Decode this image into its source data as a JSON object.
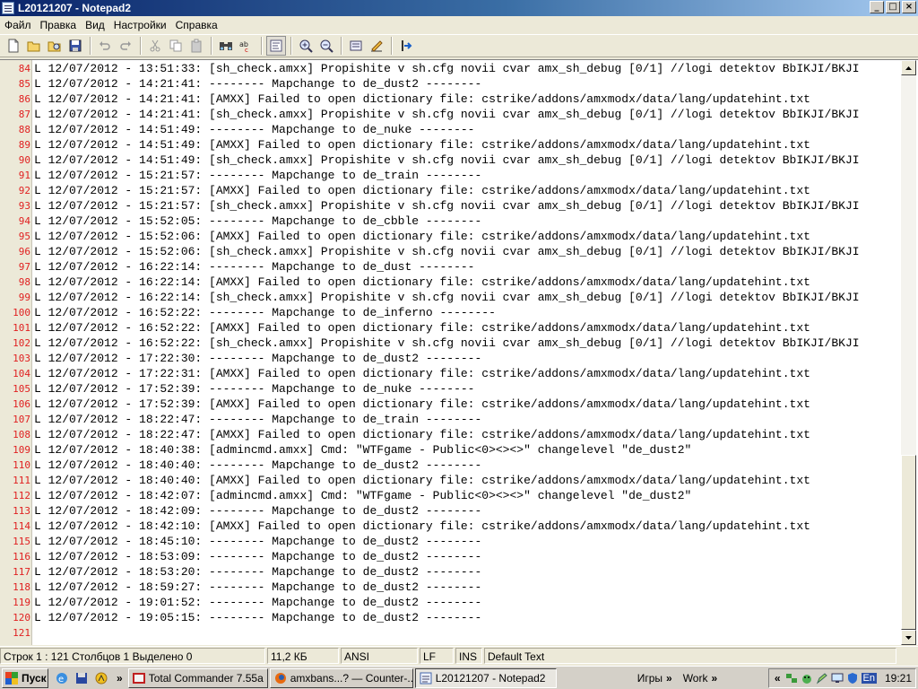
{
  "window": {
    "title": "L20121207 - Notepad2",
    "buttons": [
      "_",
      "□",
      "×"
    ]
  },
  "menu": [
    "Файл",
    "Правка",
    "Вид",
    "Настройки",
    "Справка"
  ],
  "toolbar_icons": [
    "new-file-icon",
    "open-file-icon",
    "browse-icon",
    "save-icon",
    "undo-icon",
    "redo-icon",
    "cut-icon",
    "copy-icon",
    "paste-icon",
    "find-icon",
    "replace-icon",
    "word-wrap-icon",
    "zoom-in-icon",
    "zoom-out-icon",
    "settings-icon",
    "scheme-icon",
    "exit-icon"
  ],
  "editor": {
    "lines": [
      {
        "n": "84",
        "text": "L 12/07/2012 - 13:51:33: [sh_check.amxx] Propishite v sh.cfg novii cvar amx_sh_debug [0/1] //logi detektov BbIKJI/BKJI"
      },
      {
        "n": "85",
        "text": "L 12/07/2012 - 14:21:41: -------- Mapchange to de_dust2 --------"
      },
      {
        "n": "86",
        "text": "L 12/07/2012 - 14:21:41: [AMXX] Failed to open dictionary file: cstrike/addons/amxmodx/data/lang/updatehint.txt"
      },
      {
        "n": "87",
        "text": "L 12/07/2012 - 14:21:41: [sh_check.amxx] Propishite v sh.cfg novii cvar amx_sh_debug [0/1] //logi detektov BbIKJI/BKJI"
      },
      {
        "n": "88",
        "text": "L 12/07/2012 - 14:51:49: -------- Mapchange to de_nuke --------"
      },
      {
        "n": "89",
        "text": "L 12/07/2012 - 14:51:49: [AMXX] Failed to open dictionary file: cstrike/addons/amxmodx/data/lang/updatehint.txt"
      },
      {
        "n": "90",
        "text": "L 12/07/2012 - 14:51:49: [sh_check.amxx] Propishite v sh.cfg novii cvar amx_sh_debug [0/1] //logi detektov BbIKJI/BKJI"
      },
      {
        "n": "91",
        "text": "L 12/07/2012 - 15:21:57: -------- Mapchange to de_train --------"
      },
      {
        "n": "92",
        "text": "L 12/07/2012 - 15:21:57: [AMXX] Failed to open dictionary file: cstrike/addons/amxmodx/data/lang/updatehint.txt"
      },
      {
        "n": "93",
        "text": "L 12/07/2012 - 15:21:57: [sh_check.amxx] Propishite v sh.cfg novii cvar amx_sh_debug [0/1] //logi detektov BbIKJI/BKJI"
      },
      {
        "n": "94",
        "text": "L 12/07/2012 - 15:52:05: -------- Mapchange to de_cbble --------"
      },
      {
        "n": "95",
        "text": "L 12/07/2012 - 15:52:06: [AMXX] Failed to open dictionary file: cstrike/addons/amxmodx/data/lang/updatehint.txt"
      },
      {
        "n": "96",
        "text": "L 12/07/2012 - 15:52:06: [sh_check.amxx] Propishite v sh.cfg novii cvar amx_sh_debug [0/1] //logi detektov BbIKJI/BKJI"
      },
      {
        "n": "97",
        "text": "L 12/07/2012 - 16:22:14: -------- Mapchange to de_dust --------"
      },
      {
        "n": "98",
        "text": "L 12/07/2012 - 16:22:14: [AMXX] Failed to open dictionary file: cstrike/addons/amxmodx/data/lang/updatehint.txt"
      },
      {
        "n": "99",
        "text": "L 12/07/2012 - 16:22:14: [sh_check.amxx] Propishite v sh.cfg novii cvar amx_sh_debug [0/1] //logi detektov BbIKJI/BKJI"
      },
      {
        "n": "100",
        "text": "L 12/07/2012 - 16:52:22: -------- Mapchange to de_inferno --------"
      },
      {
        "n": "101",
        "text": "L 12/07/2012 - 16:52:22: [AMXX] Failed to open dictionary file: cstrike/addons/amxmodx/data/lang/updatehint.txt"
      },
      {
        "n": "102",
        "text": "L 12/07/2012 - 16:52:22: [sh_check.amxx] Propishite v sh.cfg novii cvar amx_sh_debug [0/1] //logi detektov BbIKJI/BKJI"
      },
      {
        "n": "103",
        "text": "L 12/07/2012 - 17:22:30: -------- Mapchange to de_dust2 --------"
      },
      {
        "n": "104",
        "text": "L 12/07/2012 - 17:22:31: [AMXX] Failed to open dictionary file: cstrike/addons/amxmodx/data/lang/updatehint.txt"
      },
      {
        "n": "105",
        "text": "L 12/07/2012 - 17:52:39: -------- Mapchange to de_nuke --------"
      },
      {
        "n": "106",
        "text": "L 12/07/2012 - 17:52:39: [AMXX] Failed to open dictionary file: cstrike/addons/amxmodx/data/lang/updatehint.txt"
      },
      {
        "n": "107",
        "text": "L 12/07/2012 - 18:22:47: -------- Mapchange to de_train --------"
      },
      {
        "n": "108",
        "text": "L 12/07/2012 - 18:22:47: [AMXX] Failed to open dictionary file: cstrike/addons/amxmodx/data/lang/updatehint.txt"
      },
      {
        "n": "109",
        "text": "L 12/07/2012 - 18:40:38: [admincmd.amxx] Cmd: \"WTFgame - Public<0><><>\" changelevel \"de_dust2\""
      },
      {
        "n": "110",
        "text": "L 12/07/2012 - 18:40:40: -------- Mapchange to de_dust2 --------"
      },
      {
        "n": "111",
        "text": "L 12/07/2012 - 18:40:40: [AMXX] Failed to open dictionary file: cstrike/addons/amxmodx/data/lang/updatehint.txt"
      },
      {
        "n": "112",
        "text": "L 12/07/2012 - 18:42:07: [admincmd.amxx] Cmd: \"WTFgame - Public<0><><>\" changelevel \"de_dust2\""
      },
      {
        "n": "113",
        "text": "L 12/07/2012 - 18:42:09: -------- Mapchange to de_dust2 --------"
      },
      {
        "n": "114",
        "text": "L 12/07/2012 - 18:42:10: [AMXX] Failed to open dictionary file: cstrike/addons/amxmodx/data/lang/updatehint.txt"
      },
      {
        "n": "115",
        "text": "L 12/07/2012 - 18:45:10: -------- Mapchange to de_dust2 --------"
      },
      {
        "n": "116",
        "text": "L 12/07/2012 - 18:53:09: -------- Mapchange to de_dust2 --------"
      },
      {
        "n": "117",
        "text": "L 12/07/2012 - 18:53:20: -------- Mapchange to de_dust2 --------"
      },
      {
        "n": "118",
        "text": "L 12/07/2012 - 18:59:27: -------- Mapchange to de_dust2 --------"
      },
      {
        "n": "119",
        "text": "L 12/07/2012 - 19:01:52: -------- Mapchange to de_dust2 --------"
      },
      {
        "n": "120",
        "text": "L 12/07/2012 - 19:05:15: -------- Mapchange to de_dust2 --------"
      },
      {
        "n": "121",
        "text": ""
      }
    ]
  },
  "statusbar": {
    "position": "Строк 1 : 121  Столбцов 1  Выделено 0",
    "size": "11,2 КБ",
    "encoding": "ANSI",
    "line_ending": "LF",
    "mode": "INS",
    "scheme": "Default Text"
  },
  "taskbar": {
    "start_label": "Пуск",
    "tasks": [
      {
        "label": "Total Commander 7.55a ...",
        "icon": "total-commander-icon"
      },
      {
        "label": "amxbans...? — Counter-...",
        "icon": "firefox-icon"
      },
      {
        "label": "L20121207 - Notepad2",
        "icon": "notepad2-icon"
      }
    ],
    "toolbars": [
      "Игры",
      "Work"
    ],
    "chevron": "»",
    "tray_expand": "«",
    "language": "En",
    "clock": "19:21"
  },
  "colors": {
    "line_numbers": "#e02020",
    "title_gradient_start": "#0a246a",
    "title_gradient_end": "#a6caf0"
  }
}
